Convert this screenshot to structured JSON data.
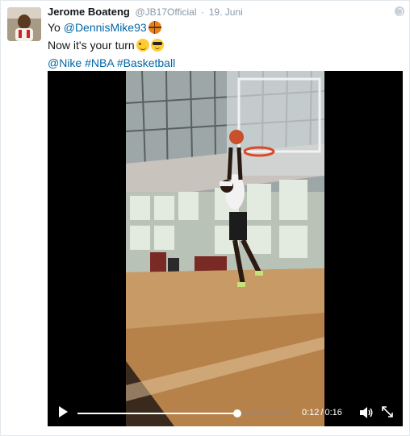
{
  "tweet": {
    "author_name": "Jerome Boateng",
    "handle": "@JB17Official",
    "separator": "·",
    "date": "19. Juni",
    "line1_prefix": "Yo ",
    "mention": "@DennisMike93",
    "line2_text": "Now it's your turn",
    "hashtag1": "@Nike",
    "hashtag2": "#NBA",
    "hashtag3": "#Basketball"
  },
  "video": {
    "current_time": "0:12",
    "time_separator": "/",
    "duration": "0:16",
    "progress": 0.75
  },
  "colors": {
    "link": "#0066a6",
    "secondary_text": "#8899a6",
    "video_bg": "#000000"
  },
  "icons": [
    "globe-icon",
    "basketball-emoji",
    "wink-emoji",
    "sunglasses-emoji",
    "play-icon",
    "volume-icon",
    "fullscreen-icon"
  ]
}
